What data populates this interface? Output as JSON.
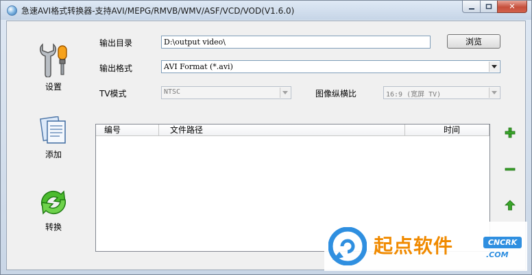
{
  "window": {
    "title": "急速AVI格式转换器-支持AVI/MEPG/RMVB/WMV/ASF/VCD/VOD(V1.6.0)",
    "controls": {
      "close_glyph": "✕"
    }
  },
  "sidebar": {
    "settings_label": "设置",
    "add_label": "添加",
    "convert_label": "转换"
  },
  "form": {
    "output_dir_label": "输出目录",
    "output_dir_value": "D:\\output video\\",
    "browse_label": "浏览",
    "output_format_label": "输出格式",
    "output_format_value": "AVI Format (*.avi)",
    "tv_mode_label": "TV模式",
    "tv_mode_value": "NTSC",
    "aspect_label": "图像纵横比",
    "aspect_value": "16:9   (宽屏 TV)"
  },
  "file_list": {
    "columns": [
      "编号",
      "文件路径",
      "时间"
    ],
    "rows": []
  },
  "watermark": {
    "brand_text": "起点软件",
    "badge_text": "CNCRK",
    "sub_text": ".COM"
  },
  "colors": {
    "accent_green": "#3aa52a",
    "watermark_orange": "#f08a00",
    "watermark_blue": "#2f8fe0"
  }
}
